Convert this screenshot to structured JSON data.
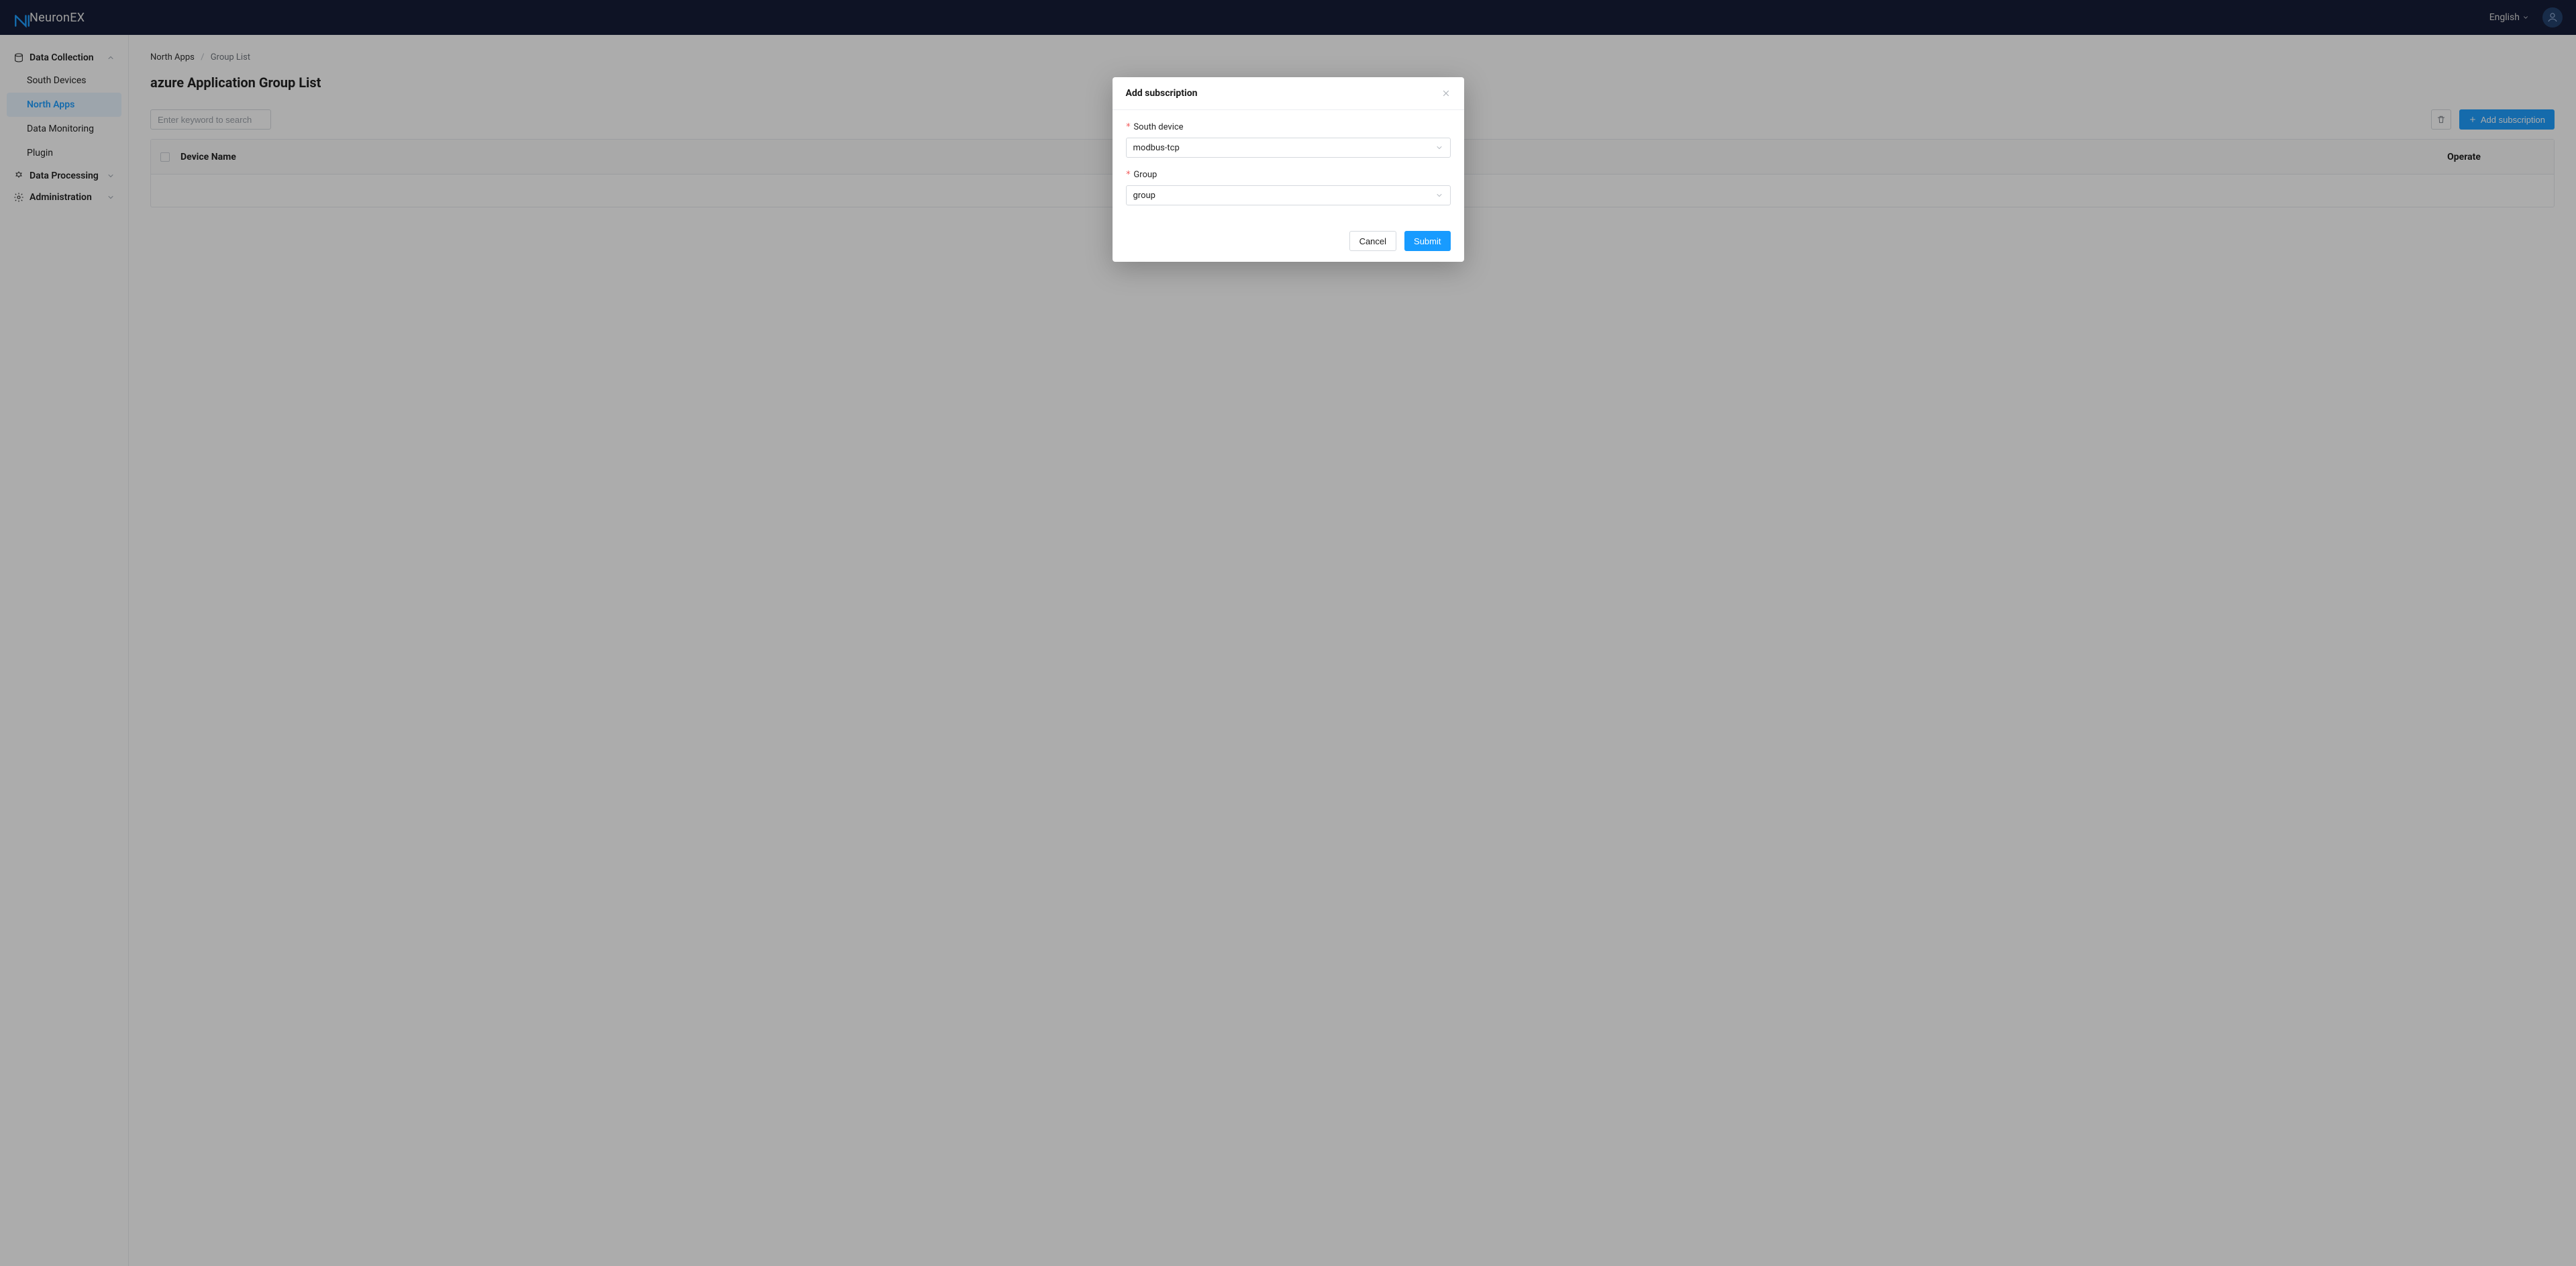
{
  "header": {
    "brand": "NeuronEX",
    "language": "English"
  },
  "sidebar": {
    "groups": {
      "data_collection": "Data Collection",
      "data_processing": "Data Processing",
      "administration": "Administration"
    },
    "items": {
      "south_devices": "South Devices",
      "north_apps": "North Apps",
      "data_monitoring": "Data Monitoring",
      "plugin": "Plugin"
    }
  },
  "crumbs": {
    "north_apps": "North Apps",
    "group_list": "Group List"
  },
  "page": {
    "title": "azure Application Group List",
    "search_placeholder": "Enter keyword to search",
    "add_subscription": "Add subscription"
  },
  "table": {
    "device_name": "Device Name",
    "operate": "Operate"
  },
  "modal": {
    "title": "Add subscription",
    "south_device_label": "South device",
    "south_device_value": "modbus-tcp",
    "group_label": "Group",
    "group_value": "group",
    "cancel": "Cancel",
    "submit": "Submit"
  }
}
